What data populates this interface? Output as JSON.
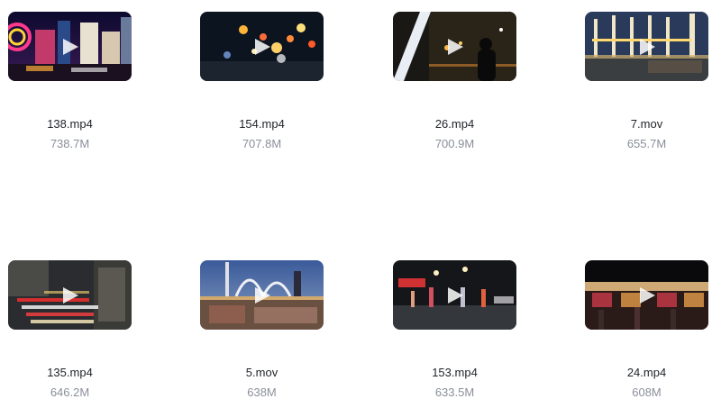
{
  "videos": [
    {
      "name": "138.mp4",
      "size": "738.7M",
      "thumbnail_icon": "city-night-neon-icon"
    },
    {
      "name": "154.mp4",
      "size": "707.8M",
      "thumbnail_icon": "bokeh-lights-icon"
    },
    {
      "name": "26.mp4",
      "size": "700.9M",
      "thumbnail_icon": "person-city-night-icon"
    },
    {
      "name": "7.mov",
      "size": "655.7M",
      "thumbnail_icon": "pier-night-icon"
    },
    {
      "name": "135.mp4",
      "size": "646.2M",
      "thumbnail_icon": "traffic-street-icon"
    },
    {
      "name": "5.mov",
      "size": "638M",
      "thumbnail_icon": "harbor-dusk-icon"
    },
    {
      "name": "153.mp4",
      "size": "633.5M",
      "thumbnail_icon": "street-crowd-night-icon"
    },
    {
      "name": "24.mp4",
      "size": "608M",
      "thumbnail_icon": "night-market-icon"
    }
  ],
  "colors": {
    "filename_text": "#1f2329",
    "size_text": "#8a8f99",
    "play_overlay": "rgba(255,255,255,0.85)"
  }
}
